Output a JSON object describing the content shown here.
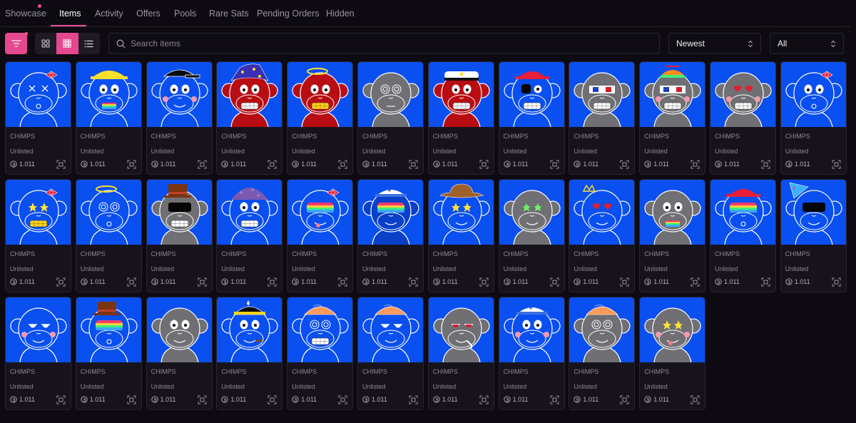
{
  "tabs": [
    {
      "label": "Showcase",
      "active": false
    },
    {
      "label": "Items",
      "active": true
    },
    {
      "label": "Activity",
      "active": false
    },
    {
      "label": "Offers",
      "active": false
    },
    {
      "label": "Pools",
      "active": false
    },
    {
      "label": "Rare Sats",
      "active": false
    },
    {
      "label": "Pending Orders",
      "active": false
    },
    {
      "label": "Hidden",
      "active": false
    }
  ],
  "toolbar": {
    "filter_icon": "filter-icon",
    "view_modes": [
      "grid-large-icon",
      "grid-small-icon",
      "list-icon"
    ],
    "active_view": 1,
    "search_placeholder": "Search items",
    "sort_value": "Newest",
    "type_value": "All"
  },
  "colors": {
    "accent": "#e5488e",
    "card_bg": "#0a4ff0",
    "page_bg": "#0d0a11"
  },
  "items": [
    {
      "name": "CHIMPS",
      "status": "Unlisted",
      "price": "1.011",
      "face": "white",
      "hat": "bow",
      "eyes": "x",
      "mouth": "o"
    },
    {
      "name": "CHIMPS",
      "status": "Unlisted",
      "price": "1.011",
      "face": "white",
      "hat": "yellowcap",
      "eyes": "dot",
      "mouth": "rainbow"
    },
    {
      "name": "CHIMPS",
      "status": "Unlisted",
      "price": "1.011",
      "face": "white",
      "hat": "blackcap",
      "eyes": "dot",
      "mouth": "smile",
      "blush": true
    },
    {
      "name": "CHIMPS",
      "status": "Unlisted",
      "price": "1.011",
      "face": "red",
      "hat": "wizard",
      "eyes": "dot",
      "mouth": "teeth"
    },
    {
      "name": "CHIMPS",
      "status": "Unlisted",
      "price": "1.011",
      "face": "red",
      "hat": "halo",
      "eyes": "dot",
      "mouth": "goldteeth"
    },
    {
      "name": "CHIMPS",
      "status": "Unlisted",
      "price": "1.011",
      "face": "gray",
      "hat": "none",
      "eyes": "spiral",
      "mouth": "flat"
    },
    {
      "name": "CHIMPS",
      "status": "Unlisted",
      "price": "1.011",
      "face": "red",
      "hat": "captain",
      "eyes": "dot",
      "mouth": "teeth"
    },
    {
      "name": "CHIMPS",
      "status": "Unlisted",
      "price": "1.011",
      "face": "white",
      "hat": "redcap",
      "eyes": "patch",
      "mouth": "teeth"
    },
    {
      "name": "CHIMPS",
      "status": "Unlisted",
      "price": "1.011",
      "face": "gray",
      "hat": "none",
      "eyes": "3d",
      "mouth": "teeth"
    },
    {
      "name": "CHIMPS",
      "status": "Unlisted",
      "price": "1.011",
      "face": "gray",
      "hat": "propeller",
      "eyes": "3d",
      "mouth": "teeth",
      "blush": true
    },
    {
      "name": "CHIMPS",
      "status": "Unlisted",
      "price": "1.011",
      "face": "gray",
      "hat": "none",
      "eyes": "heart",
      "mouth": "teeth",
      "blush": true
    },
    {
      "name": "CHIMPS",
      "status": "Unlisted",
      "price": "1.011",
      "face": "white",
      "hat": "bow",
      "eyes": "dot",
      "mouth": "o"
    },
    {
      "name": "CHIMPS",
      "status": "Unlisted",
      "price": "1.011",
      "face": "white",
      "hat": "bow",
      "eyes": "star",
      "mouth": "goldteeth"
    },
    {
      "name": "CHIMPS",
      "status": "Unlisted",
      "price": "1.011",
      "face": "white",
      "hat": "halo",
      "eyes": "spiral",
      "mouth": "o"
    },
    {
      "name": "CHIMPS",
      "status": "Unlisted",
      "price": "1.011",
      "face": "gray",
      "hat": "tophat",
      "eyes": "shades",
      "mouth": "teeth"
    },
    {
      "name": "CHIMPS",
      "status": "Unlisted",
      "price": "1.011",
      "face": "white",
      "hat": "brain",
      "eyes": "dot",
      "mouth": "teeth"
    },
    {
      "name": "CHIMPS",
      "status": "Unlisted",
      "price": "1.011",
      "face": "white",
      "hat": "bow",
      "eyes": "rainbow",
      "mouth": "tongue"
    },
    {
      "name": "CHIMPS",
      "status": "Unlisted",
      "price": "1.011",
      "face": "blue",
      "hat": "sailor",
      "eyes": "rainbow",
      "mouth": "smile"
    },
    {
      "name": "CHIMPS",
      "status": "Unlisted",
      "price": "1.011",
      "face": "white",
      "hat": "cowboy",
      "eyes": "star",
      "mouth": "smile"
    },
    {
      "name": "CHIMPS",
      "status": "Unlisted",
      "price": "1.011",
      "face": "gray",
      "hat": "none",
      "eyes": "greenstar",
      "mouth": "smile"
    },
    {
      "name": "CHIMPS",
      "status": "Unlisted",
      "price": "1.011",
      "face": "white",
      "hat": "crown",
      "eyes": "heart",
      "mouth": "smile"
    },
    {
      "name": "CHIMPS",
      "status": "Unlisted",
      "price": "1.011",
      "face": "gray",
      "hat": "none",
      "eyes": "dot",
      "mouth": "rainbow"
    },
    {
      "name": "CHIMPS",
      "status": "Unlisted",
      "price": "1.011",
      "face": "white",
      "hat": "redcap",
      "eyes": "rainbow",
      "mouth": "o"
    },
    {
      "name": "CHIMPS",
      "status": "Unlisted",
      "price": "1.011",
      "face": "white",
      "hat": "party",
      "eyes": "shades",
      "mouth": "smile"
    },
    {
      "name": "CHIMPS",
      "status": "Unlisted",
      "price": "1.011",
      "face": "white",
      "hat": "none",
      "eyes": "tired",
      "mouth": "smile",
      "blush": true
    },
    {
      "name": "CHIMPS",
      "status": "Unlisted",
      "price": "1.011",
      "face": "white",
      "hat": "tophat",
      "eyes": "rainbow",
      "mouth": "o"
    },
    {
      "name": "CHIMPS",
      "status": "Unlisted",
      "price": "1.011",
      "face": "gray",
      "hat": "none",
      "eyes": "dot",
      "mouth": "smile"
    },
    {
      "name": "CHIMPS",
      "status": "Unlisted",
      "price": "1.011",
      "face": "white",
      "hat": "pilot",
      "eyes": "dot",
      "mouth": "cigar"
    },
    {
      "name": "CHIMPS",
      "status": "Unlisted",
      "price": "1.011",
      "face": "white",
      "hat": "orangecap",
      "eyes": "spiral",
      "mouth": "teeth2"
    },
    {
      "name": "CHIMPS",
      "status": "Unlisted",
      "price": "1.011",
      "face": "white",
      "hat": "orangecap",
      "eyes": "tired",
      "mouth": "smile"
    },
    {
      "name": "CHIMPS",
      "status": "Unlisted",
      "price": "1.011",
      "face": "gray",
      "hat": "none",
      "eyes": "redtired",
      "mouth": "pipe"
    },
    {
      "name": "CHIMPS",
      "status": "Unlisted",
      "price": "1.011",
      "face": "white",
      "hat": "sailor",
      "eyes": "dot",
      "mouth": "smile",
      "blush": true
    },
    {
      "name": "CHIMPS",
      "status": "Unlisted",
      "price": "1.011",
      "face": "gray",
      "hat": "orangecap",
      "eyes": "spiral",
      "mouth": "smile"
    },
    {
      "name": "CHIMPS",
      "status": "Unlisted",
      "price": "1.011",
      "face": "gray",
      "hat": "none",
      "eyes": "star",
      "mouth": "tongue",
      "blush": true
    }
  ]
}
